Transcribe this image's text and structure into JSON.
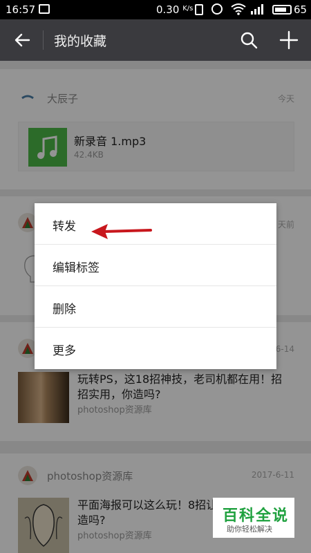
{
  "status_bar": {
    "time": "16:57",
    "speed": "0.30",
    "speed_unit": "K/s",
    "battery": "65"
  },
  "header": {
    "title": "我的收藏",
    "back_icon": "back-arrow-icon",
    "search_icon": "search-icon",
    "add_icon": "plus-icon"
  },
  "favorites": [
    {
      "source": "大辰子",
      "date": "今天",
      "file_name": "新录音 1.mp3",
      "file_size": "42.4KB",
      "file_icon": "music-note-icon"
    },
    {
      "date": "天前"
    },
    {
      "date": "6-14",
      "title": "玩转PS，这18招神技，老司机都在用！招招实用，你造吗?",
      "source": "photoshop资源库"
    },
    {
      "source": "photoshop资源库",
      "date": "2017-6-11",
      "title": "平面海报可以这么玩！8招让",
      "title_line2": "造吗?",
      "sub": "photoshop资源库"
    }
  ],
  "context_menu": {
    "items": [
      "转发",
      "编辑标签",
      "删除",
      "更多"
    ]
  },
  "watermark": {
    "main": "百科全说",
    "sub": "助你轻松解决"
  },
  "colors": {
    "header_bg": "#3a3a3e",
    "music_green": "#4cb848",
    "arrow_red": "#c8171d",
    "watermark_green": "#1fa13f"
  }
}
